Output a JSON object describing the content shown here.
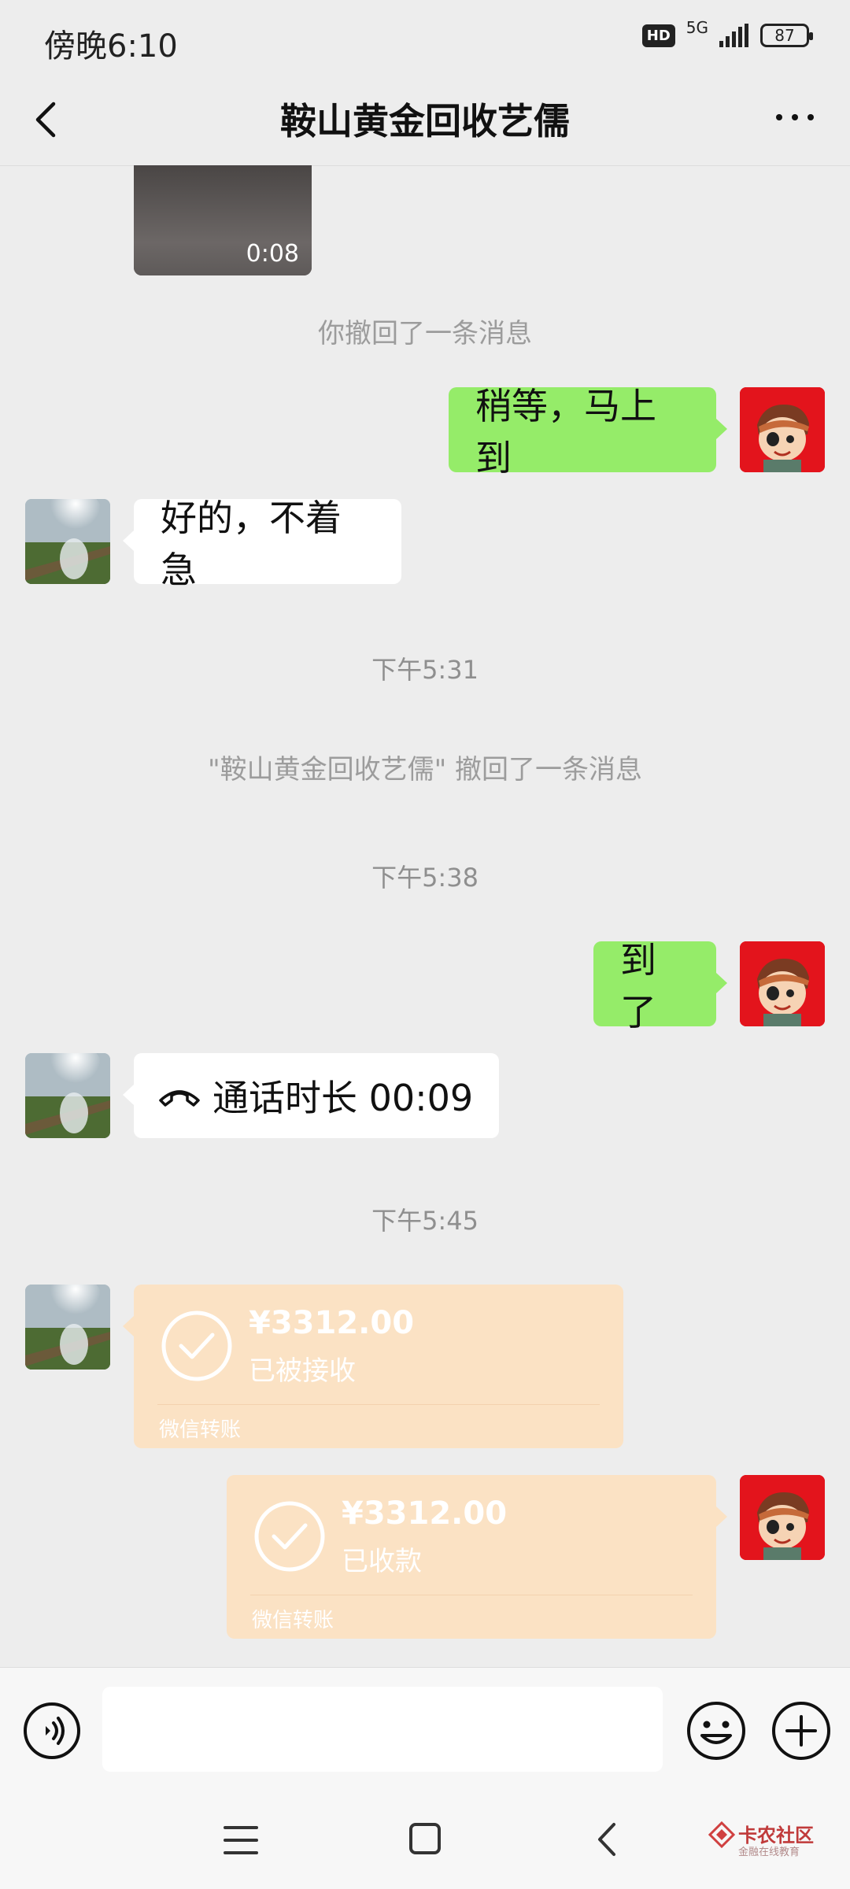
{
  "status_bar": {
    "time": "傍晚6:10",
    "hd": "HD",
    "network": "5G",
    "battery": "87"
  },
  "header": {
    "title": "鞍山黄金回收艺儒"
  },
  "messages": {
    "video_duration": "0:08",
    "you_recalled": "你撤回了一条消息",
    "me_wait": "稍等，马上到",
    "other_ok": "好的，不着急",
    "time_531": "下午5:31",
    "other_recalled": "\"鞍山黄金回收艺儒\" 撤回了一条消息",
    "time_538": "下午5:38",
    "me_arrived": "到了",
    "call_duration": "通话时长 00:09",
    "time_545": "下午5:45"
  },
  "transfers": [
    {
      "amount": "¥3312.00",
      "status": "已被接收",
      "footer": "微信转账"
    },
    {
      "amount": "¥3312.00",
      "status": "已收款",
      "footer": "微信转账"
    }
  ],
  "input": {
    "placeholder": ""
  },
  "watermark": {
    "title": "卡农社区",
    "subtitle": "金融在线教育"
  },
  "colors": {
    "background": "#ededed",
    "my_bubble": "#95ec69",
    "other_bubble": "#ffffff",
    "transfer_done": "#fbe2c4",
    "my_avatar": "#e3141c"
  }
}
